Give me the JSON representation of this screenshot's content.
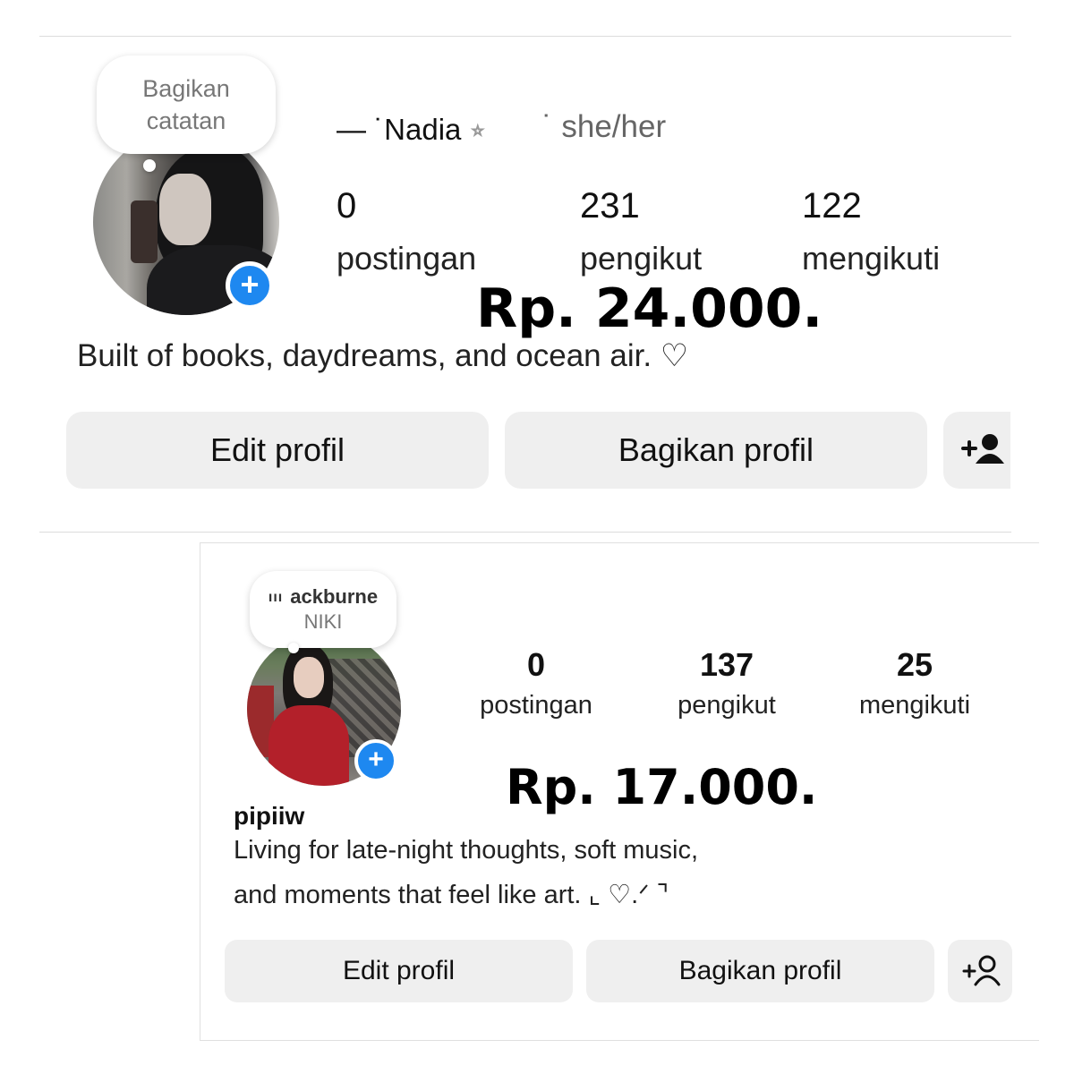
{
  "profile1": {
    "note": [
      "Bagikan",
      "catatan"
    ],
    "name": "— ˙Nadia",
    "name_symbol": "⭒",
    "pronouns": "˙ she/her",
    "stats": [
      {
        "value": "0",
        "label": "postingan"
      },
      {
        "value": "231",
        "label": "pengikut"
      },
      {
        "value": "122",
        "label": "mengikuti"
      }
    ],
    "price": "Rp. 24.000.",
    "bio": "Built of books, daydreams, and ocean air. ♡",
    "buttons": {
      "edit": "Edit profil",
      "share": "Bagikan profil"
    }
  },
  "profile2": {
    "note_song": "ackburne",
    "note_bars": "ııı",
    "note_artist": "NIKI",
    "stats": [
      {
        "value": "0",
        "label": "postingan"
      },
      {
        "value": "137",
        "label": "pengikut"
      },
      {
        "value": "25",
        "label": "mengikuti"
      }
    ],
    "price": "Rp. 17.000.",
    "username": "pipiiw",
    "bio_lines": [
      "Living for late-night thoughts, soft music,",
      "and moments that feel like art. ⌞ ♡.ᐟ ⌝"
    ],
    "buttons": {
      "edit": "Edit profil",
      "share": "Bagikan profil"
    }
  },
  "icons": {
    "plus": "+",
    "add_person": "add-person-icon"
  },
  "colors": {
    "accent": "#1e88f0",
    "button_bg": "#efefef"
  }
}
